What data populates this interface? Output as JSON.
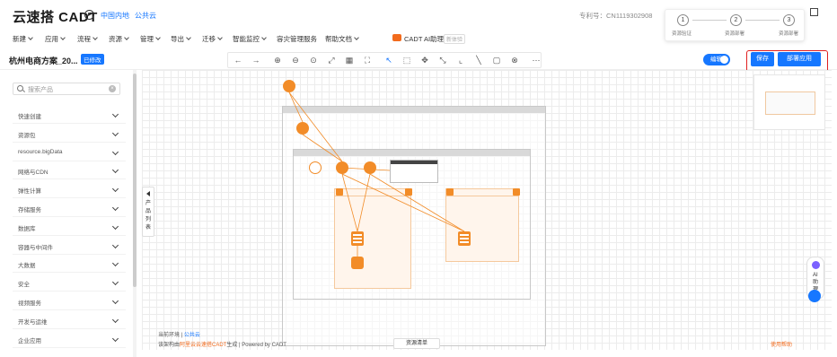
{
  "header": {
    "brand": "云速搭 CADT",
    "env_cn": "中国内地",
    "env_public": "公共云",
    "patent": "专利号：CN1119302908"
  },
  "menu": [
    {
      "label": "新建",
      "dropdown": true
    },
    {
      "label": "应用",
      "dropdown": true
    },
    {
      "label": "流程",
      "dropdown": true
    },
    {
      "label": "资源",
      "dropdown": true
    },
    {
      "label": "管理",
      "dropdown": true
    },
    {
      "label": "导出",
      "dropdown": true
    },
    {
      "label": "迁移",
      "dropdown": true
    },
    {
      "label": "智能监控",
      "dropdown": true
    },
    {
      "label": "容灾管理服务",
      "dropdown": false
    },
    {
      "label": "帮助文档",
      "dropdown": true
    }
  ],
  "ai": {
    "label": "CADT AI助理",
    "tag": "新体验"
  },
  "steps": [
    {
      "num": "1",
      "label": "资源验证"
    },
    {
      "num": "2",
      "label": "资源部署"
    },
    {
      "num": "3",
      "label": "资源部署"
    }
  ],
  "toolbar": {
    "project_title": "杭州电商方案_20...",
    "edit_badge": "已修改",
    "edit_toggle": "编辑",
    "save": "保存",
    "deploy": "部署应用"
  },
  "sidebar": {
    "search_placeholder": "搜索产品",
    "categories": [
      "快速创建",
      "资源包",
      "resource.bigData",
      "网络与CDN",
      "弹性计算",
      "存储服务",
      "数据库",
      "容器与中间件",
      "大数据",
      "安全",
      "视频服务",
      "开发与运维",
      "企业应用"
    ],
    "collapse_label": "产品列表"
  },
  "canvas": {
    "ai_float_label": "AI助理",
    "env_label": "当前环境 |",
    "env_value": "公共云",
    "gen_prefix": "该架构由",
    "gen_link": "阿里云云速搭CADT",
    "gen_suffix": "生成 | Powered by CADT",
    "resource_list": "资源清单",
    "help": "使用帮助"
  },
  "colors": {
    "accent": "#1677ff",
    "orange": "#f28c28",
    "highlight": "#e02020"
  }
}
